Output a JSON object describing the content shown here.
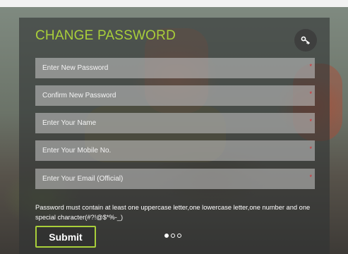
{
  "form": {
    "title": "CHANGE PASSWORD",
    "key_icon": "key-icon",
    "fields": [
      {
        "placeholder": "Enter New Password",
        "value": "",
        "required_mark": "*"
      },
      {
        "placeholder": "Confirm New Password",
        "value": "",
        "required_mark": "*"
      },
      {
        "placeholder": "Enter Your Name",
        "value": "",
        "required_mark": "*"
      },
      {
        "placeholder": "Enter Your Mobile No.",
        "value": "",
        "required_mark": "*"
      },
      {
        "placeholder": "Enter Your Email (Official)",
        "value": "",
        "required_mark": "*"
      }
    ],
    "hint": "Password must contain at least one uppercase letter,one lowercase letter,one number and one special character(#?!@$*%-_)",
    "submit_label": "Submit"
  },
  "carousel": {
    "total": 3,
    "active_index": 0
  },
  "colors": {
    "accent": "#a9cf3a",
    "required": "#e0242b",
    "panel": "#303434"
  }
}
